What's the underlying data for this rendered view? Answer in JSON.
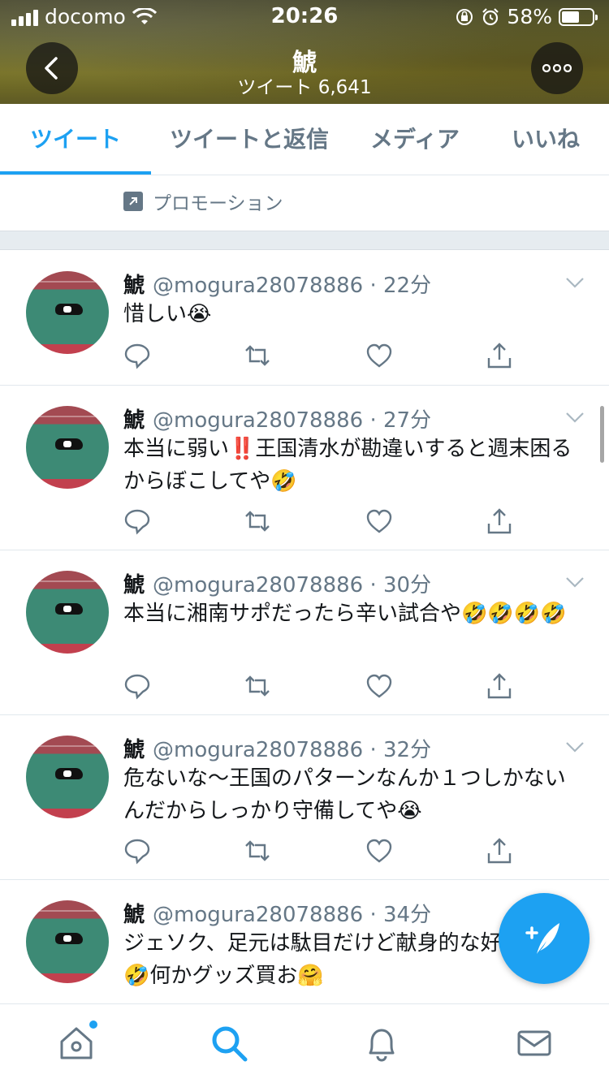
{
  "status_bar": {
    "carrier": "docomo",
    "time": "20:26",
    "battery": "58%",
    "battery_level": 0.58
  },
  "header": {
    "name": "鯱",
    "tweet_count": "ツイート 6,641"
  },
  "tabs": [
    {
      "label": "ツイート"
    },
    {
      "label": "ツイートと返信"
    },
    {
      "label": "メディア"
    },
    {
      "label": "いいね"
    }
  ],
  "promo": {
    "label": "プロモーション"
  },
  "tweets": [
    {
      "name": "鯱",
      "handle": "@mogura28078886 · 22分",
      "text": "惜しい😭"
    },
    {
      "name": "鯱",
      "handle": "@mogura28078886 · 27分",
      "text": "本当に弱い‼️王国清水が勘違いすると週末困るからぼこしてや🤣"
    },
    {
      "name": "鯱",
      "handle": "@mogura28078886 · 30分",
      "text": "本当に湘南サポだったら辛い試合や🤣🤣🤣🤣"
    },
    {
      "name": "鯱",
      "handle": "@mogura28078886 · 32分",
      "text": "危ないな〜王国のパターンなんか１つしかないんだからしっかり守備してや😭"
    },
    {
      "name": "鯱",
      "handle": "@mogura28078886 · 34分",
      "text": "ジェソク、足元は駄目だけど献身的な好きやな。🤣何かグッズ買お🤗"
    }
  ],
  "icons": {
    "back": "chevron-left-icon",
    "more": "more-icon",
    "reply": "reply-icon",
    "retweet": "retweet-icon",
    "like": "heart-icon",
    "share": "share-icon",
    "compose": "compose-tweet-icon",
    "home": "home-icon",
    "search": "search-icon",
    "notifications": "bell-icon",
    "messages": "mail-icon"
  },
  "colors": {
    "accent": "#1da1f2",
    "muted": "#657786",
    "text": "#14171a"
  }
}
